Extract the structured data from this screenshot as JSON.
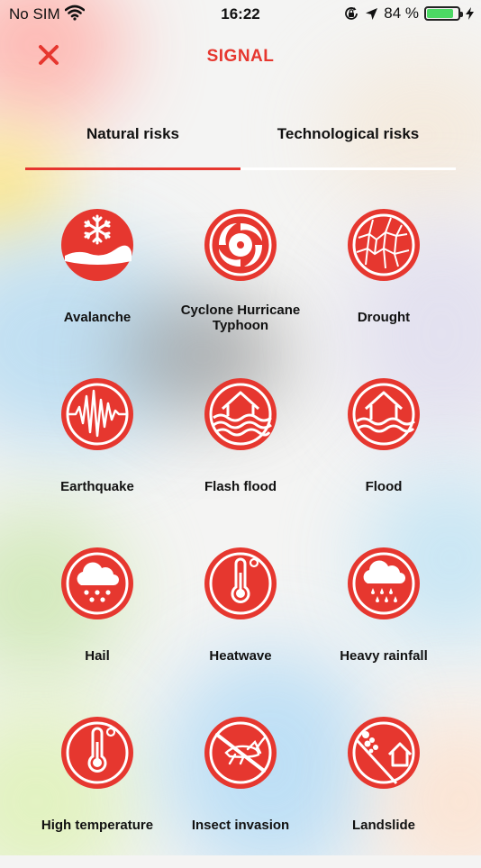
{
  "status_bar": {
    "carrier": "No SIM",
    "time": "16:22",
    "battery_percent": "84 %",
    "battery_level": 0.84
  },
  "header": {
    "title": "SIGNAL"
  },
  "tabs": [
    {
      "label": "Natural risks",
      "selected": true
    },
    {
      "label": "Technological risks",
      "selected": false
    }
  ],
  "colors": {
    "accent": "#e6372f",
    "battery": "#4cd964"
  },
  "risks": [
    {
      "label": "Avalanche",
      "icon": "avalanche-icon"
    },
    {
      "label": "Cyclone Hurricane Typhoon",
      "icon": "cyclone-icon"
    },
    {
      "label": "Drought",
      "icon": "drought-icon"
    },
    {
      "label": "Earthquake",
      "icon": "earthquake-icon"
    },
    {
      "label": "Flash flood",
      "icon": "flash-flood-icon"
    },
    {
      "label": "Flood",
      "icon": "flood-icon"
    },
    {
      "label": "Hail",
      "icon": "hail-icon"
    },
    {
      "label": "Heatwave",
      "icon": "heatwave-icon"
    },
    {
      "label": "Heavy rainfall",
      "icon": "heavy-rainfall-icon"
    },
    {
      "label": "High temperature",
      "icon": "high-temperature-icon"
    },
    {
      "label": "Insect invasion",
      "icon": "insect-invasion-icon"
    },
    {
      "label": "Landslide",
      "icon": "landslide-icon"
    }
  ]
}
